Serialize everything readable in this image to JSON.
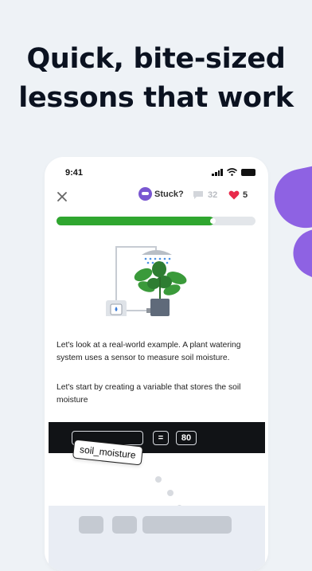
{
  "headline": {
    "line1": "Quick, bite-sized",
    "line2": "lessons that work"
  },
  "status_bar": {
    "time": "9:41"
  },
  "toolbar": {
    "close_icon": "close-icon",
    "stuck_label": "Stuck?",
    "hints_count": "32",
    "lives_count": "5"
  },
  "progress": {
    "fraction": 0.79
  },
  "lesson": {
    "paragraph1": "Let's look at a real-world example. A plant watering system uses a sensor to measure soil moisture.",
    "paragraph2": "Let's start by creating a variable that stores the soil moisture"
  },
  "code": {
    "operator": "=",
    "value": "80"
  },
  "drag_option": {
    "label": "soil_moisture"
  },
  "colors": {
    "background": "#eef2f6",
    "accent_purple": "#8e62e3",
    "progress_green": "#2fa62f",
    "heart_red": "#e8294a",
    "code_bar": "#111316"
  }
}
